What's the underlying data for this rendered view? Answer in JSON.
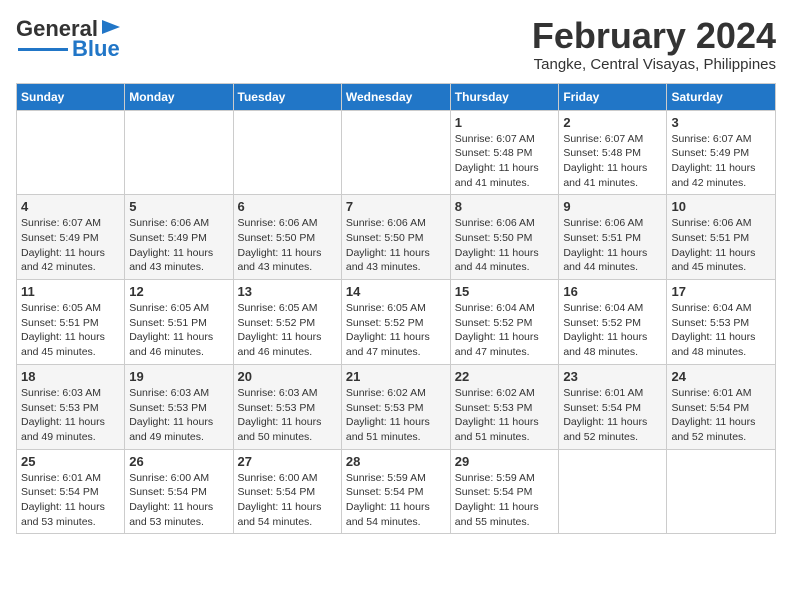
{
  "header": {
    "logo_text_general": "General",
    "logo_text_blue": "Blue",
    "main_title": "February 2024",
    "subtitle": "Tangke, Central Visayas, Philippines"
  },
  "days_of_week": [
    "Sunday",
    "Monday",
    "Tuesday",
    "Wednesday",
    "Thursday",
    "Friday",
    "Saturday"
  ],
  "weeks": [
    [
      {
        "day": "",
        "info": ""
      },
      {
        "day": "",
        "info": ""
      },
      {
        "day": "",
        "info": ""
      },
      {
        "day": "",
        "info": ""
      },
      {
        "day": "1",
        "info": "Sunrise: 6:07 AM\nSunset: 5:48 PM\nDaylight: 11 hours and 41 minutes."
      },
      {
        "day": "2",
        "info": "Sunrise: 6:07 AM\nSunset: 5:48 PM\nDaylight: 11 hours and 41 minutes."
      },
      {
        "day": "3",
        "info": "Sunrise: 6:07 AM\nSunset: 5:49 PM\nDaylight: 11 hours and 42 minutes."
      }
    ],
    [
      {
        "day": "4",
        "info": "Sunrise: 6:07 AM\nSunset: 5:49 PM\nDaylight: 11 hours and 42 minutes."
      },
      {
        "day": "5",
        "info": "Sunrise: 6:06 AM\nSunset: 5:49 PM\nDaylight: 11 hours and 43 minutes."
      },
      {
        "day": "6",
        "info": "Sunrise: 6:06 AM\nSunset: 5:50 PM\nDaylight: 11 hours and 43 minutes."
      },
      {
        "day": "7",
        "info": "Sunrise: 6:06 AM\nSunset: 5:50 PM\nDaylight: 11 hours and 43 minutes."
      },
      {
        "day": "8",
        "info": "Sunrise: 6:06 AM\nSunset: 5:50 PM\nDaylight: 11 hours and 44 minutes."
      },
      {
        "day": "9",
        "info": "Sunrise: 6:06 AM\nSunset: 5:51 PM\nDaylight: 11 hours and 44 minutes."
      },
      {
        "day": "10",
        "info": "Sunrise: 6:06 AM\nSunset: 5:51 PM\nDaylight: 11 hours and 45 minutes."
      }
    ],
    [
      {
        "day": "11",
        "info": "Sunrise: 6:05 AM\nSunset: 5:51 PM\nDaylight: 11 hours and 45 minutes."
      },
      {
        "day": "12",
        "info": "Sunrise: 6:05 AM\nSunset: 5:51 PM\nDaylight: 11 hours and 46 minutes."
      },
      {
        "day": "13",
        "info": "Sunrise: 6:05 AM\nSunset: 5:52 PM\nDaylight: 11 hours and 46 minutes."
      },
      {
        "day": "14",
        "info": "Sunrise: 6:05 AM\nSunset: 5:52 PM\nDaylight: 11 hours and 47 minutes."
      },
      {
        "day": "15",
        "info": "Sunrise: 6:04 AM\nSunset: 5:52 PM\nDaylight: 11 hours and 47 minutes."
      },
      {
        "day": "16",
        "info": "Sunrise: 6:04 AM\nSunset: 5:52 PM\nDaylight: 11 hours and 48 minutes."
      },
      {
        "day": "17",
        "info": "Sunrise: 6:04 AM\nSunset: 5:53 PM\nDaylight: 11 hours and 48 minutes."
      }
    ],
    [
      {
        "day": "18",
        "info": "Sunrise: 6:03 AM\nSunset: 5:53 PM\nDaylight: 11 hours and 49 minutes."
      },
      {
        "day": "19",
        "info": "Sunrise: 6:03 AM\nSunset: 5:53 PM\nDaylight: 11 hours and 49 minutes."
      },
      {
        "day": "20",
        "info": "Sunrise: 6:03 AM\nSunset: 5:53 PM\nDaylight: 11 hours and 50 minutes."
      },
      {
        "day": "21",
        "info": "Sunrise: 6:02 AM\nSunset: 5:53 PM\nDaylight: 11 hours and 51 minutes."
      },
      {
        "day": "22",
        "info": "Sunrise: 6:02 AM\nSunset: 5:53 PM\nDaylight: 11 hours and 51 minutes."
      },
      {
        "day": "23",
        "info": "Sunrise: 6:01 AM\nSunset: 5:54 PM\nDaylight: 11 hours and 52 minutes."
      },
      {
        "day": "24",
        "info": "Sunrise: 6:01 AM\nSunset: 5:54 PM\nDaylight: 11 hours and 52 minutes."
      }
    ],
    [
      {
        "day": "25",
        "info": "Sunrise: 6:01 AM\nSunset: 5:54 PM\nDaylight: 11 hours and 53 minutes."
      },
      {
        "day": "26",
        "info": "Sunrise: 6:00 AM\nSunset: 5:54 PM\nDaylight: 11 hours and 53 minutes."
      },
      {
        "day": "27",
        "info": "Sunrise: 6:00 AM\nSunset: 5:54 PM\nDaylight: 11 hours and 54 minutes."
      },
      {
        "day": "28",
        "info": "Sunrise: 5:59 AM\nSunset: 5:54 PM\nDaylight: 11 hours and 54 minutes."
      },
      {
        "day": "29",
        "info": "Sunrise: 5:59 AM\nSunset: 5:54 PM\nDaylight: 11 hours and 55 minutes."
      },
      {
        "day": "",
        "info": ""
      },
      {
        "day": "",
        "info": ""
      }
    ]
  ]
}
